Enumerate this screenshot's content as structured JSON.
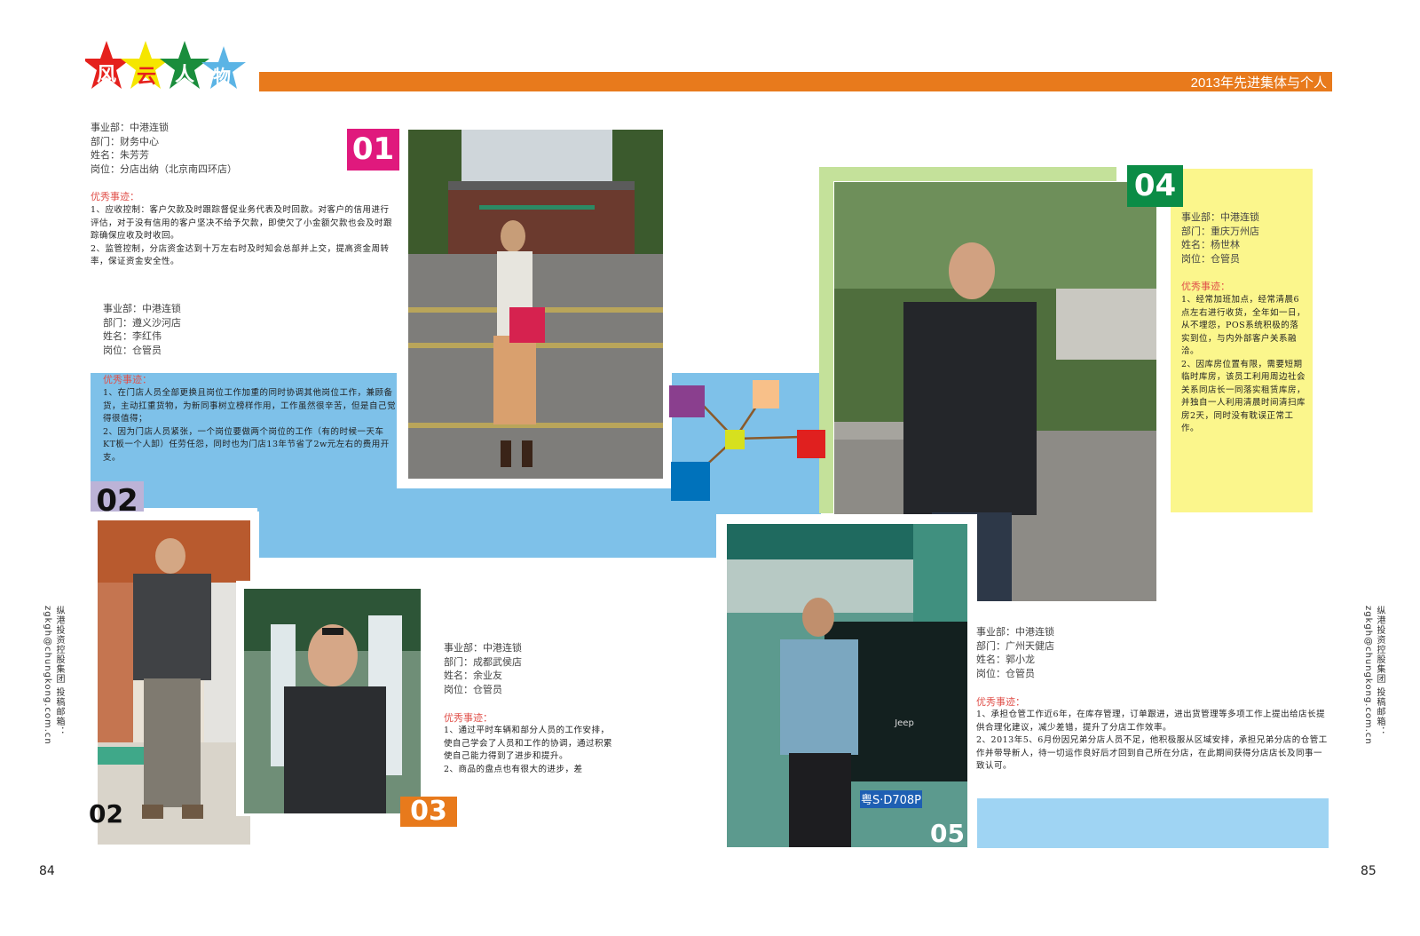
{
  "header": {
    "logo": {
      "chars": [
        "风",
        "云",
        "人",
        "物"
      ],
      "colors": [
        "#e5211d",
        "#f5e600",
        "#1a8d3c",
        "#5bb4e5"
      ]
    },
    "banner_title": "2013年先进集体与个人"
  },
  "margins": {
    "left": "纵港投资控股集团 投稿邮箱：zgkgh@chungkong.com.cn",
    "right": "纵港投资控股集团 投稿邮箱：zgkgh@chungkong.com.cn"
  },
  "page_numbers": {
    "left": "84",
    "right": "85"
  },
  "profiles": [
    {
      "num": "01",
      "lines": [
        "事业部：中港连锁",
        "部门：财务中心",
        "姓名：朱芳芳",
        "岗位：分店出纳（北京南四环店）"
      ],
      "deeds_title": "优秀事迹：",
      "deeds": [
        "1、应收控制：客户欠款及时跟踪督促业务代表及时回款。对客户的信用进行评估，对于没有信用的客户坚决不给予欠款，即使欠了小金额欠款也会及时跟踪确保应收及时收回。",
        "2、监管控制，分店资金达到十万左右时及时知会总部并上交，提高资金周转率，保证资金安全性。"
      ]
    },
    {
      "num": "02",
      "lines": [
        "事业部：中港连锁",
        "部门：遵义沙河店",
        "姓名：李红伟",
        "岗位：仓管员"
      ],
      "deeds_title": "优秀事迹：",
      "deeds": [
        "1、在门店人员全部更换且岗位工作加重的同时协调其他岗位工作，兼顾备货，主动扛重货物，为新同事树立榜样作用，工作虽然很辛苦，但是自己觉得很值得；",
        "2、因为门店人员紧张，一个岗位要做两个岗位的工作（有的时候一天车KT板一个人卸）任劳任怨，同时也为门店13年节省了2w元左右的费用开支。"
      ]
    },
    {
      "num": "03",
      "lines": [
        "事业部：中港连锁",
        "部门：成都武侯店",
        "姓名：余业友",
        "岗位：仓管员"
      ],
      "deeds_title": "优秀事迹：",
      "deeds": [
        "1、通过平时车辆和部分人员的工作安排，使自己学会了人员和工作的协调，通过积累使自己能力得到了进步和提升。",
        "2、商品的盘点也有很大的进步，差"
      ]
    },
    {
      "num": "04",
      "lines": [
        "事业部：中港连锁",
        "部门：重庆万州店",
        "姓名：杨世林",
        "岗位：仓管员"
      ],
      "deeds_title": "优秀事迹：",
      "deeds": [
        "1、经常加班加点，经常清晨6点左右进行收货，全年如一日，从不埋怨，POS系统积极的落实到位，与内外部客户关系融洽。",
        "2、因库房位置有限，需要短期临时库房，该员工利用周边社会关系同店长一同落实租赁库房，并独自一人利用清晨时间清扫库房2天，同时没有耽误正常工作。"
      ]
    },
    {
      "num": "05",
      "lines": [
        "事业部：中港连锁",
        "部门：广州天健店",
        "姓名：郭小龙",
        "岗位：仓管员"
      ],
      "deeds_title": "优秀事迹：",
      "deeds": [
        "1、承担仓管工作近6年，在库存管理，订单跟进，进出货管理等多项工作上提出给店长提供合理化建议，减少差错，提升了分店工作效率。",
        "2、2013年5、6月份因兄弟分店人员不足，他积极服从区域安排，承担兄弟分店的仓管工作并带导新人，待一切运作良好后才回到自己所在分店，在此期间获得分店店长及同事一致认可。"
      ]
    }
  ],
  "photo_text": {
    "plate": "粤S·D708P",
    "jeep": "Jeep"
  }
}
